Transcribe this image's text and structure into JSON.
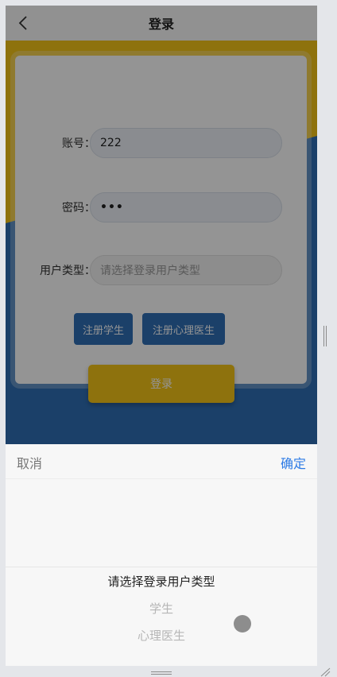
{
  "navbar": {
    "title": "登录"
  },
  "form": {
    "account_label": "账号：",
    "account_value": "222",
    "password_label": "密码：",
    "password_value": "•••",
    "user_type_label": "用户类型：",
    "user_type_placeholder": "请选择登录用户类型",
    "register_student_label": "注册学生",
    "register_doctor_label": "注册心理医生",
    "login_label": "登录"
  },
  "picker": {
    "cancel_label": "取消",
    "confirm_label": "确定",
    "options": [
      "请选择登录用户类型",
      "学生",
      "心理医生"
    ],
    "selected_index": 0
  },
  "colors": {
    "accent_yellow": "#f5c518",
    "accent_blue": "#2f6fb5",
    "confirm_blue": "#2d7be5"
  }
}
